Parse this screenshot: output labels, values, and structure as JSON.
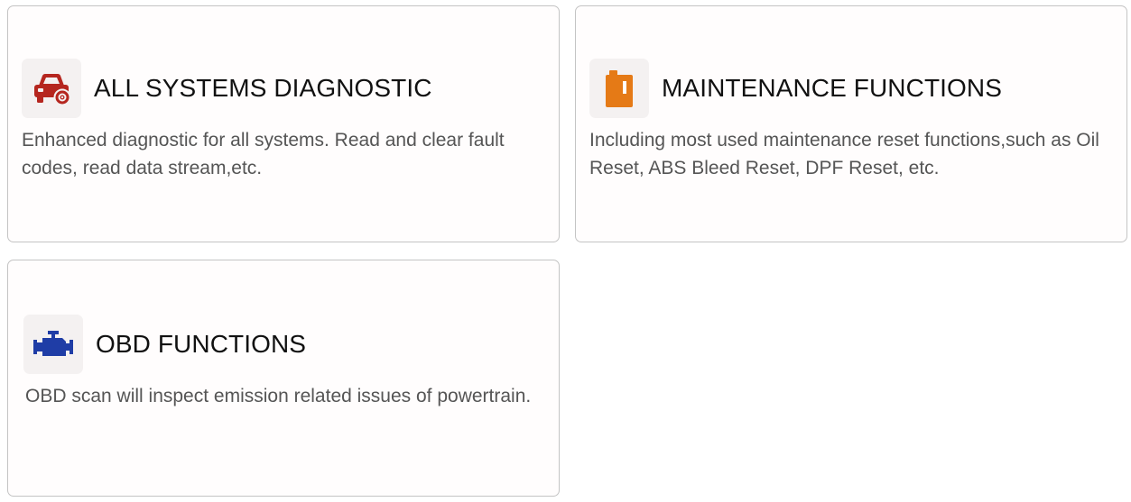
{
  "cards": [
    {
      "id": "all-systems",
      "title": "ALL SYSTEMS DIAGNOSTIC",
      "description": "Enhanced diagnostic for all systems. Read and clear fault codes, read data stream,etc.",
      "icon": "car-diagnostic-icon",
      "icon_color": "#b5261f"
    },
    {
      "id": "maintenance",
      "title": "MAINTENANCE FUNCTIONS",
      "description": "Including most used maintenance reset functions,such as Oil Reset, ABS Bleed Reset, DPF Reset, etc.",
      "icon": "oil-can-icon",
      "icon_color": "#e57a16"
    },
    {
      "id": "obd",
      "title": "OBD FUNCTIONS",
      "description": "OBD scan will inspect emission related issues of powertrain.",
      "icon": "engine-icon",
      "icon_color": "#1f3da6"
    }
  ]
}
